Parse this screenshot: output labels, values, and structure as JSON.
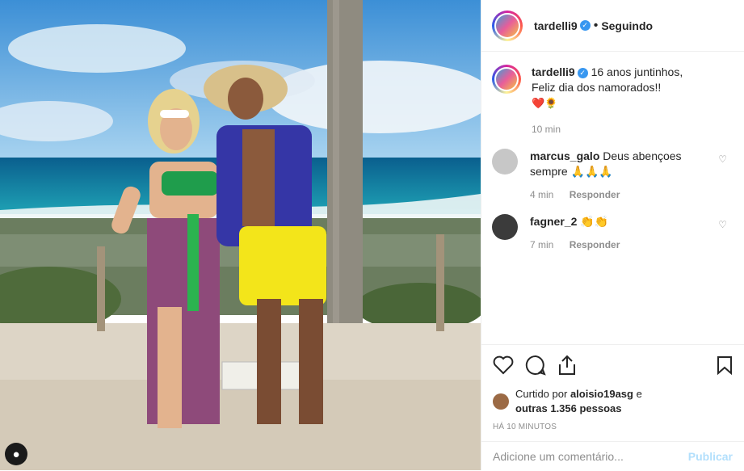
{
  "post": {
    "username": "tardelli9",
    "follow_status": "Seguindo",
    "caption_line1": "16 anos juntinhos,",
    "caption_line2": "Feliz dia dos namorados!!",
    "caption_emoji": "❤️🌻",
    "caption_time": "10 min"
  },
  "comments": [
    {
      "username": "marcus_galo",
      "text": "Deus abençoes sempre 🙏🙏🙏",
      "time": "4 min",
      "reply": "Responder"
    },
    {
      "username": "fagner_2",
      "text": "👏👏",
      "time": "7 min",
      "reply": "Responder"
    }
  ],
  "likes": {
    "prefix": "Curtido por",
    "liker": "aloisio19asg",
    "suffix": "e",
    "others": "outras 1.356 pessoas"
  },
  "posted_ago": "HÁ 10 MINUTOS",
  "comment_input": {
    "placeholder": "Adicione um comentário...",
    "publish": "Publicar"
  },
  "colors": {
    "verified": "#3897f0",
    "muted": "#8e8e8e",
    "publish": "#b2dffc"
  }
}
